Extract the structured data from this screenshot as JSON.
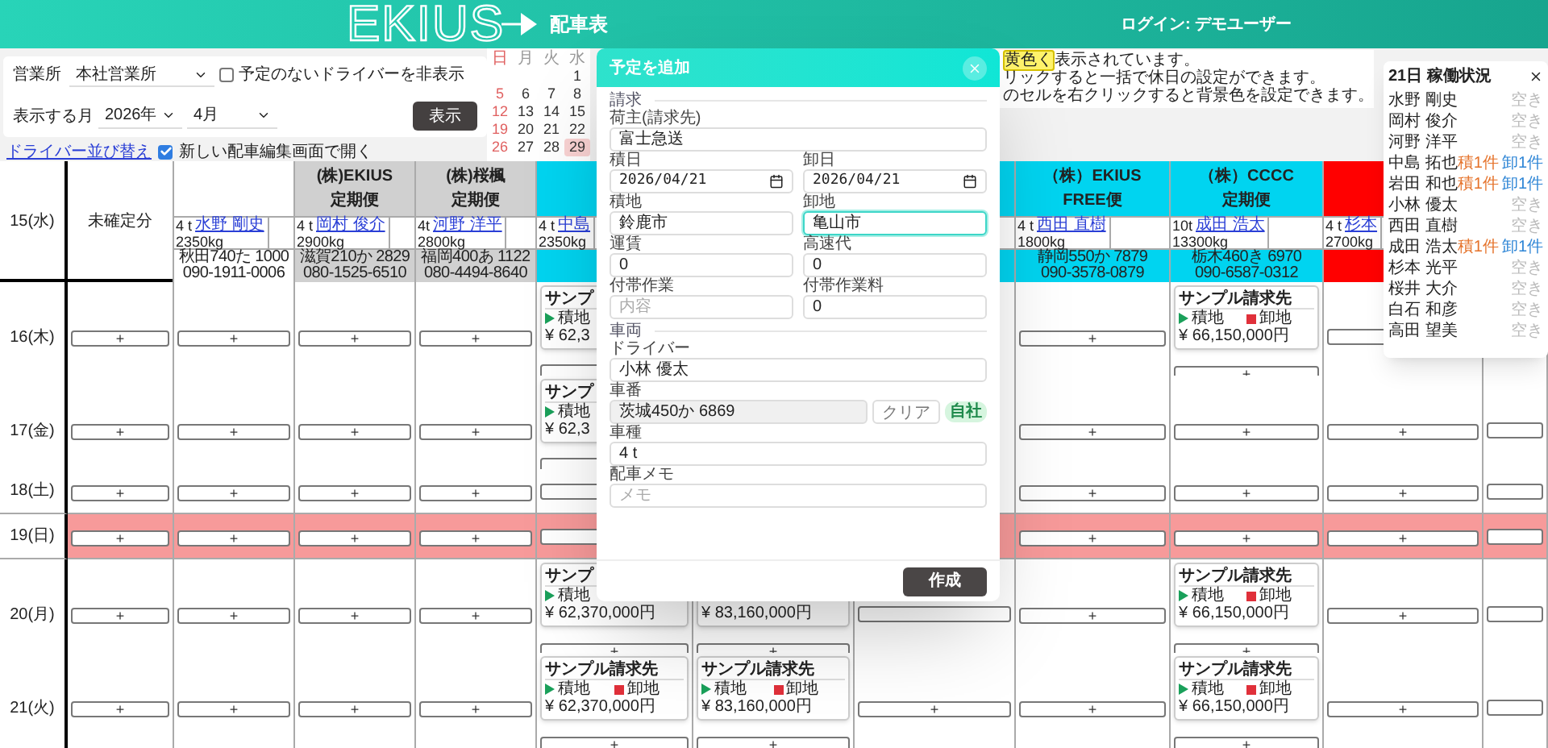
{
  "header": {
    "logo": "EKIUS",
    "title": "配車表",
    "login": "ログイン: デモユーザー"
  },
  "filters": {
    "office_label": "営業所",
    "office": "本社営業所",
    "hide_idle": {
      "label": "予定のないドライバーを非表示",
      "checked": false
    },
    "month_label": "表示する月",
    "year": "2026年",
    "month": "4月",
    "show_button": "表示"
  },
  "links": {
    "sort": "ドライバー並び替え",
    "new_editor": {
      "label": "新しい配車編集画面で開く",
      "checked": true
    }
  },
  "mini_calendar": {
    "weekdays": [
      "日",
      "月",
      "火",
      "水"
    ],
    "weeks": [
      [
        {
          "day": "1",
          "selected": false
        }
      ],
      [
        {
          "day": "5",
          "selected": false
        },
        {
          "day": "6",
          "selected": false
        },
        {
          "day": "7",
          "selected": false
        },
        {
          "day": "8",
          "selected": false
        }
      ],
      [
        {
          "day": "12",
          "selected": false
        },
        {
          "day": "13",
          "selected": false
        },
        {
          "day": "14",
          "selected": false
        },
        {
          "day": "15",
          "selected": false
        }
      ],
      [
        {
          "day": "19",
          "selected": false
        },
        {
          "day": "20",
          "selected": false
        },
        {
          "day": "21",
          "selected": false
        },
        {
          "day": "22",
          "selected": false
        }
      ],
      [
        {
          "day": "26",
          "selected": false
        },
        {
          "day": "27",
          "selected": false
        },
        {
          "day": "28",
          "selected": false
        },
        {
          "day": "29",
          "selected": true
        }
      ]
    ]
  },
  "notice": [
    [
      {
        "text": "黄色く",
        "highlight": true
      },
      {
        "text": "表示されています。",
        "highlight": false
      }
    ],
    [
      {
        "text": "リックすると一括で休日の設定ができます。",
        "highlight": false
      }
    ],
    [
      {
        "text": "のセルを右クリックすると背景色を設定できます。",
        "highlight": false
      }
    ]
  ],
  "table": {
    "date_header": "15(水)",
    "columns": [
      {
        "kind": "pending",
        "label": "未確定分"
      },
      {
        "kind": "driver",
        "color": "#ffffff",
        "size": "4 t",
        "driver": "水野 剛史",
        "weight": "2350kg",
        "plate": "秋田740た 1000",
        "phone": "090-1911-0006"
      },
      {
        "kind": "driver",
        "color": "#d0d0d0",
        "company": "(株)EKIUS",
        "service": "定期便",
        "size": "4 t",
        "driver": "岡村 俊介",
        "weight": "2900kg",
        "plate": "滋賀210か 2829",
        "phone": "080-1525-6510"
      },
      {
        "kind": "driver",
        "color": "#d0d0d0",
        "company": "(株)桜楓",
        "service": "定期便",
        "size": "4t",
        "driver": "河野 洋平",
        "weight": "2800kg",
        "plate": "福岡400あ 1122",
        "phone": "080-4494-8640"
      },
      {
        "kind": "driver",
        "color": "#00d4f0",
        "size": "4 t",
        "driver": "中島",
        "weight": "2350kg"
      },
      {
        "kind": "driver"
      },
      {
        "kind": "driver",
        "color": "#00d4f0"
      },
      {
        "kind": "driver",
        "color": "#00d4f0",
        "company": "（株）EKIUS",
        "service": "FREE便",
        "size": "4 t",
        "driver": "西田 直樹",
        "weight": "1800kg",
        "plate": "静岡550か 7879",
        "phone": "090-3578-0879"
      },
      {
        "kind": "driver",
        "color": "#00d4f0",
        "company": "（株）CCCC",
        "service": "定期便",
        "size": "10t",
        "driver": "成田 浩太",
        "weight": "13300kg",
        "plate": "栃木460き 6970",
        "phone": "090-6587-0312"
      },
      {
        "kind": "driver",
        "color": "#ff0000",
        "size": "4 t",
        "driver": "杉本",
        "weight": "2700kg"
      },
      {
        "kind": "driver"
      }
    ],
    "rows": [
      {
        "date": "16(木)",
        "holiday": false,
        "cells": [
          {
            "kind": "add",
            "add": "+"
          },
          {
            "kind": "add",
            "add": "+"
          },
          {
            "kind": "add",
            "add": "+"
          },
          {
            "kind": "add",
            "add": "+"
          },
          {
            "kind": "card",
            "client": "サンプ",
            "load": "積地",
            "amount": "¥ 62,3"
          },
          {
            "kind": "covered"
          },
          {
            "kind": "hidden"
          },
          {
            "kind": "add",
            "add": "+"
          },
          {
            "kind": "card",
            "client": "サンプル請求先",
            "load": "積地",
            "unload": "卸地",
            "amount": "¥ 66,150,000円",
            "add": "+"
          },
          {
            "kind": "frame"
          },
          {
            "kind": "hidden"
          }
        ]
      },
      {
        "date": "17(金)",
        "holiday": false,
        "cells": [
          {
            "kind": "add",
            "add": "+"
          },
          {
            "kind": "add",
            "add": "+"
          },
          {
            "kind": "add",
            "add": "+"
          },
          {
            "kind": "add",
            "add": "+"
          },
          {
            "kind": "card",
            "client": "サンプ",
            "load": "積地",
            "amount": "¥ 62,3"
          },
          {
            "kind": "covered"
          },
          {
            "kind": "hidden"
          },
          {
            "kind": "add",
            "add": "+"
          },
          {
            "kind": "add",
            "add": "+"
          },
          {
            "kind": "add",
            "add": "+"
          },
          {
            "kind": "frame"
          }
        ]
      },
      {
        "date": "18(土)",
        "holiday": false,
        "cells": [
          {
            "kind": "add",
            "add": "+"
          },
          {
            "kind": "add",
            "add": "+"
          },
          {
            "kind": "add",
            "add": "+"
          },
          {
            "kind": "add",
            "add": "+"
          },
          {
            "kind": "frame"
          },
          {
            "kind": "covered"
          },
          {
            "kind": "hidden"
          },
          {
            "kind": "add",
            "add": "+"
          },
          {
            "kind": "add",
            "add": "+"
          },
          {
            "kind": "add",
            "add": "+"
          },
          {
            "kind": "frame"
          }
        ]
      },
      {
        "date": "19(日)",
        "holiday": true,
        "cells": [
          {
            "kind": "add",
            "add": "+"
          },
          {
            "kind": "add",
            "add": "+"
          },
          {
            "kind": "add",
            "add": "+"
          },
          {
            "kind": "add",
            "add": "+"
          },
          {
            "kind": "frame"
          },
          {
            "kind": "covered"
          },
          {
            "kind": "hidden"
          },
          {
            "kind": "add",
            "add": "+"
          },
          {
            "kind": "add",
            "add": "+"
          },
          {
            "kind": "add",
            "add": "+"
          },
          {
            "kind": "frame"
          }
        ]
      },
      {
        "date": "20(月)",
        "holiday": false,
        "cells": [
          {
            "kind": "add",
            "add": "+"
          },
          {
            "kind": "add",
            "add": "+"
          },
          {
            "kind": "add",
            "add": "+"
          },
          {
            "kind": "add",
            "add": "+"
          },
          {
            "kind": "card",
            "client": "サンプ",
            "load": "積地",
            "amount": "¥ 62,370,000円",
            "add": "+"
          },
          {
            "kind": "card",
            "amount": "¥ 83,160,000円",
            "add": "+"
          },
          {
            "kind": "frame"
          },
          {
            "kind": "add",
            "add": "+"
          },
          {
            "kind": "card",
            "client": "サンプル請求先",
            "load": "積地",
            "unload": "卸地",
            "amount": "¥ 66,150,000円",
            "add": "+"
          },
          {
            "kind": "add",
            "add": "+"
          },
          {
            "kind": "frame"
          }
        ]
      },
      {
        "date": "21(火)",
        "holiday": false,
        "cells": [
          {
            "kind": "add",
            "add": "+"
          },
          {
            "kind": "add",
            "add": "+"
          },
          {
            "kind": "add",
            "add": "+"
          },
          {
            "kind": "add",
            "add": "+"
          },
          {
            "kind": "card",
            "client": "サンプル請求先",
            "load": "積地",
            "unload": "卸地",
            "amount": "¥ 62,370,000円",
            "add": "+"
          },
          {
            "kind": "card",
            "client": "サンプル請求先",
            "load": "積地",
            "unload": "卸地",
            "amount": "¥ 83,160,000円",
            "add": "+"
          },
          {
            "kind": "add",
            "add": "+"
          },
          {
            "kind": "add",
            "add": "+"
          },
          {
            "kind": "card",
            "client": "サンプル請求先",
            "load": "積地",
            "unload": "卸地",
            "amount": "¥ 66,150,000円",
            "add": "+"
          },
          {
            "kind": "add",
            "add": "+"
          },
          {
            "kind": "frame"
          }
        ]
      }
    ]
  },
  "dialog": {
    "title": "予定を追加",
    "billing_heading": "請求",
    "shipper": {
      "label": "荷主(請求先)",
      "value": "富士急送"
    },
    "load_date": {
      "label": "積日",
      "value": "2026/04/21"
    },
    "unload_date": {
      "label": "卸日",
      "value": "2026/04/21"
    },
    "load_place": {
      "label": "積地",
      "value": "鈴鹿市",
      "focused": false
    },
    "unload_place": {
      "label": "卸地",
      "value": "亀山市",
      "focused": true
    },
    "fare": {
      "label": "運賃",
      "value": "0"
    },
    "toll": {
      "label": "高速代",
      "value": "0"
    },
    "extra_work": {
      "label": "付帯作業",
      "placeholder": "内容"
    },
    "extra_fee": {
      "label": "付帯作業料",
      "value": "0"
    },
    "vehicle_heading": "車両",
    "driver": {
      "label": "ドライバー",
      "value": "小林 優太"
    },
    "plate": {
      "label": "車番",
      "value": "茨城450か 6869"
    },
    "clear_button": "クリア",
    "owned_badge": "自社",
    "truck_type": {
      "label": "車種",
      "value": "4 t"
    },
    "memo": {
      "label": "配車メモ",
      "placeholder": "メモ"
    },
    "submit": "作成"
  },
  "status_popup": {
    "title": "21日 稼働状況",
    "drivers": [
      {
        "name": "水野 剛史",
        "status": [
          {
            "text": "空き",
            "kind": "free"
          }
        ]
      },
      {
        "name": "岡村 俊介",
        "status": [
          {
            "text": "空き",
            "kind": "free"
          }
        ]
      },
      {
        "name": "河野 洋平",
        "status": [
          {
            "text": "空き",
            "kind": "free"
          }
        ]
      },
      {
        "name": "中島 拓也",
        "status": [
          {
            "text": "積1件",
            "kind": "load"
          },
          {
            "text": "卸1件",
            "kind": "unload"
          }
        ]
      },
      {
        "name": "岩田 和也",
        "status": [
          {
            "text": "積1件",
            "kind": "load"
          },
          {
            "text": "卸1件",
            "kind": "unload"
          }
        ]
      },
      {
        "name": "小林 優太",
        "status": [
          {
            "text": "空き",
            "kind": "free"
          }
        ]
      },
      {
        "name": "西田 直樹",
        "status": [
          {
            "text": "空き",
            "kind": "free"
          }
        ]
      },
      {
        "name": "成田 浩太",
        "status": [
          {
            "text": "積1件",
            "kind": "load"
          },
          {
            "text": "卸1件",
            "kind": "unload"
          }
        ]
      },
      {
        "name": "杉本 光平",
        "status": [
          {
            "text": "空き",
            "kind": "free"
          }
        ]
      },
      {
        "name": "桜井 大介",
        "status": [
          {
            "text": "空き",
            "kind": "free"
          }
        ]
      },
      {
        "name": "白石 和彦",
        "status": [
          {
            "text": "空き",
            "kind": "free"
          }
        ]
      },
      {
        "name": "高田 望美",
        "status": [
          {
            "text": "空き",
            "kind": "free"
          }
        ]
      }
    ]
  }
}
